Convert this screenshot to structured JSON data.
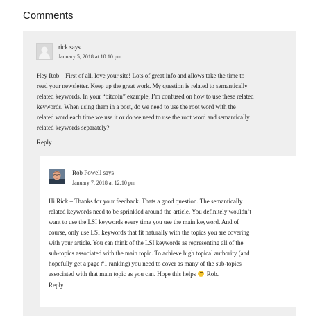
{
  "heading": "Comments",
  "comment": {
    "author": "rick says",
    "date": "January 5, 2018 at 10:10 pm",
    "body_lines": [
      "Hey Rob – First of all, love your site! Lots of great info and allows take the time to",
      "read your newsletter. Keep up the great work. My question is related to semantically",
      "related keywords. In your “bitcoin” example, I’m confused on how to use these related",
      "keywords. When using them in a post, do we need to use the root word with the",
      "related word each time we use it or do we need to use the root word and semantically",
      "related keywords separately?"
    ],
    "reply_label": "Reply"
  },
  "reply": {
    "author": "Rob Powell says",
    "date": "January 7, 2018 at 12:10 pm",
    "body_lines": [
      "Hi Rick – Thanks for your feedback. Thats a good question. The semantically",
      "related keywords need to be sprinkled around the article. You definitely wouldn’t",
      "want to use the LSI keywords every time you use the main keyword. And of",
      "course, only use LSI keywords that fit naturally with the topics you are covering",
      "with your article. You can think of the LSI keywords as representing all of the",
      "sub-topics associated with the main topic. To achieve high topical authority (and",
      "hopefully get a page #1 ranking) you need to cover as many of the sub-topics"
    ],
    "last_line_before": "associated with that main topic as you can. Hope this helps",
    "last_line_after": "Rob.",
    "reply_label": "Reply"
  }
}
